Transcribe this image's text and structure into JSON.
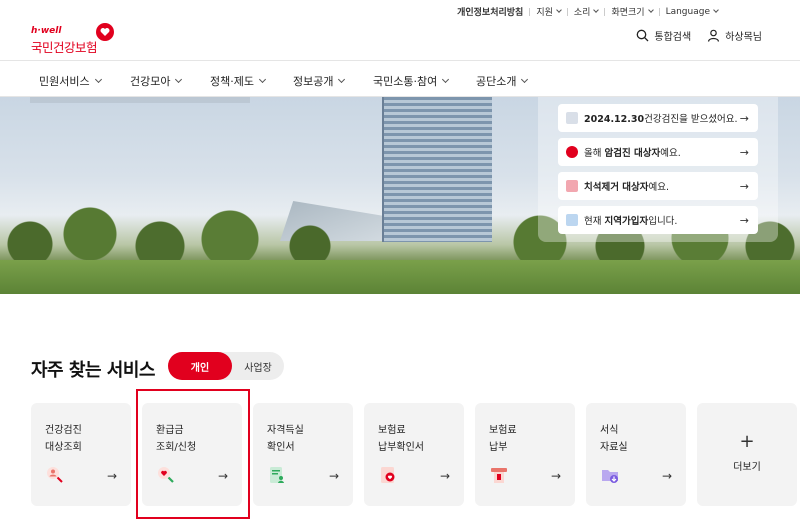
{
  "utility": {
    "privacy": "개인정보처리방침",
    "items": [
      "지원",
      "소리",
      "화면크기",
      "Language"
    ]
  },
  "logo": {
    "tagline": "h·well",
    "name": "국민건강보험"
  },
  "header": {
    "search": "통합검색",
    "user": "하상목님"
  },
  "gnb": [
    "민원서비스",
    "건강모아",
    "정책·제도",
    "정보공개",
    "국민소통·참여",
    "공단소개"
  ],
  "notices": [
    {
      "pre": "",
      "bold": "2024.12.30",
      "post": "건강검진을 받으셨어요.",
      "icon_color": "#d9dfe8"
    },
    {
      "pre": "올해 ",
      "bold": "암검진 대상자",
      "post": "예요.",
      "icon_color": "#e1001e"
    },
    {
      "pre": "",
      "bold": "치석제거 대상자",
      "post": "예요.",
      "icon_color": "#f2a7b0"
    },
    {
      "pre": "현재 ",
      "bold": "지역가입자",
      "post": "입니다.",
      "icon_color": "#bcd6f0"
    }
  ],
  "services": {
    "title": "자주 찾는 서비스",
    "tab_personal": "개인",
    "tab_business": "사업장",
    "cards": [
      {
        "label": "건강검진\n대상조회",
        "icon": "person-search-icon"
      },
      {
        "label": "환급금\n조회/신청",
        "icon": "magnifier-heart-icon"
      },
      {
        "label": "자격득실\n확인서",
        "icon": "document-person-icon"
      },
      {
        "label": "보험료\n납부확인서",
        "icon": "document-heart-icon"
      },
      {
        "label": "보험료\n납부",
        "icon": "payment-icon"
      },
      {
        "label": "서식\n자료실",
        "icon": "folder-download-icon"
      }
    ],
    "more": "더보기"
  },
  "colors": {
    "brand": "#e1001e"
  }
}
